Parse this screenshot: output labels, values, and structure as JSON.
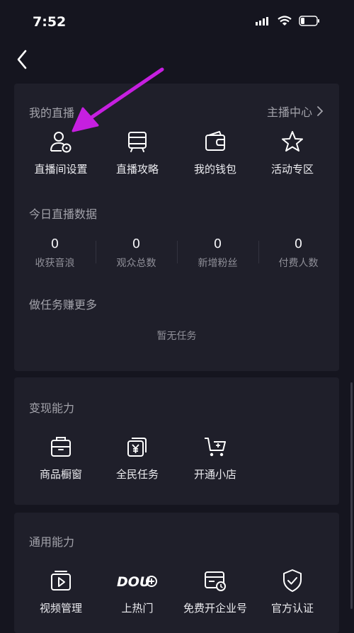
{
  "status_bar": {
    "time": "7:52"
  },
  "live": {
    "section_title": "我的直播",
    "center_link": "主播中心",
    "tiles": [
      {
        "label": "直播间设置",
        "icon": "user-settings-icon"
      },
      {
        "label": "直播攻略",
        "icon": "guide-icon"
      },
      {
        "label": "我的钱包",
        "icon": "wallet-icon"
      },
      {
        "label": "活动专区",
        "icon": "star-icon"
      }
    ],
    "stats_title": "今日直播数据",
    "stats": [
      {
        "value": "0",
        "label": "收获音浪"
      },
      {
        "value": "0",
        "label": "观众总数"
      },
      {
        "value": "0",
        "label": "新增粉丝"
      },
      {
        "value": "0",
        "label": "付费人数"
      }
    ],
    "tasks_title": "做任务赚更多",
    "tasks_empty": "暂无任务"
  },
  "monetize": {
    "section_title": "变现能力",
    "tiles": [
      {
        "label": "商品橱窗",
        "icon": "store-box-icon"
      },
      {
        "label": "全民任务",
        "icon": "task-yuan-icon"
      },
      {
        "label": "开通小店",
        "icon": "cart-icon"
      }
    ]
  },
  "general": {
    "section_title": "通用能力",
    "tiles": [
      {
        "label": "视频管理",
        "icon": "video-manage-icon"
      },
      {
        "label": "上热门",
        "icon": "dou-plus-icon"
      },
      {
        "label": "免费开企业号",
        "icon": "enterprise-icon"
      },
      {
        "label": "官方认证",
        "icon": "shield-check-icon"
      }
    ]
  },
  "colors": {
    "background": "#15151f",
    "card": "#1f1f2a",
    "annotation_arrow": "#c61fe0"
  }
}
